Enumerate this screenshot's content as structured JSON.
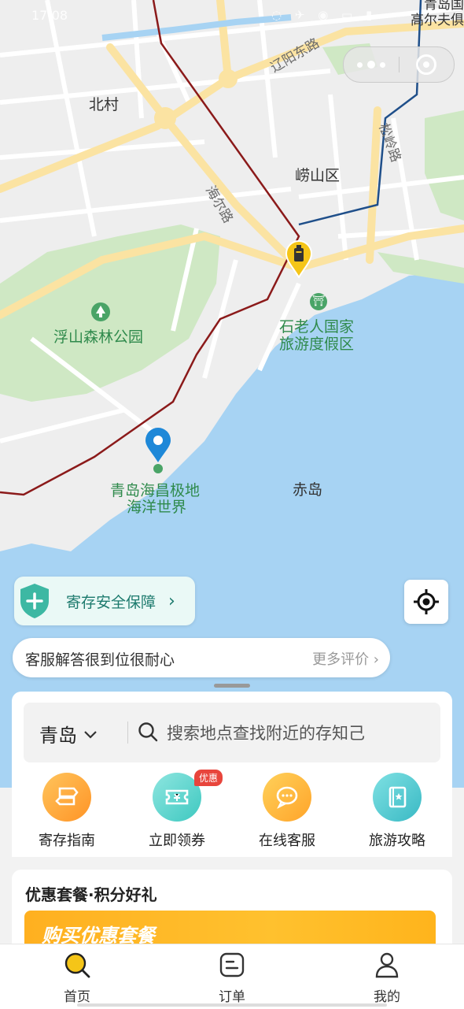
{
  "status_bar": {
    "time": "17:08",
    "icons": "◌ ✈ ◉ ▭ ▮"
  },
  "map": {
    "labels": {
      "beicun": "北村",
      "laoshan": "崂山区",
      "fushan_park": "浮山森林公园",
      "shilaoren_line1": "石老人国家",
      "shilaoren_line2": "旅游度假区",
      "haichang_line1": "青岛海昌极地",
      "haichang_line2": "海洋世界",
      "chidao": "赤岛",
      "corner_poi_line1": "青岛国",
      "corner_poi_line2": "高尔夫俱"
    },
    "roads": {
      "liaoyang_east": "辽阳东路",
      "haier": "海尔路",
      "songling": "松岭路"
    }
  },
  "capsule": {
    "more_icon": "more-dots-icon",
    "close_icon": "mini-program-close-icon"
  },
  "security": {
    "label": "寄存安全保障",
    "arrow": "›"
  },
  "review": {
    "text": "客服解答很到位很耐心",
    "more": "更多评价 ›"
  },
  "search": {
    "city": "青岛",
    "placeholder": "搜索地点查找附近的存知己"
  },
  "quick_actions": [
    {
      "label": "寄存指南",
      "icon": "signpost-icon"
    },
    {
      "label": "立即领券",
      "icon": "coupon-icon",
      "badge": "优惠"
    },
    {
      "label": "在线客服",
      "icon": "chat-bubble-icon"
    },
    {
      "label": "旅游攻略",
      "icon": "guidebook-icon"
    }
  ],
  "promo": {
    "title": "优惠套餐·积分好礼",
    "banner_text": "购买优惠套餐"
  },
  "tabs": [
    {
      "label": "首页",
      "icon": "search-home-icon",
      "active": true
    },
    {
      "label": "订单",
      "icon": "order-list-icon"
    },
    {
      "label": "我的",
      "icon": "profile-icon"
    }
  ],
  "colors": {
    "accent_yellow": "#f5c518",
    "teal": "#1c7a6d",
    "sea": "#a7d3f3",
    "park": "#cfe8c4"
  }
}
